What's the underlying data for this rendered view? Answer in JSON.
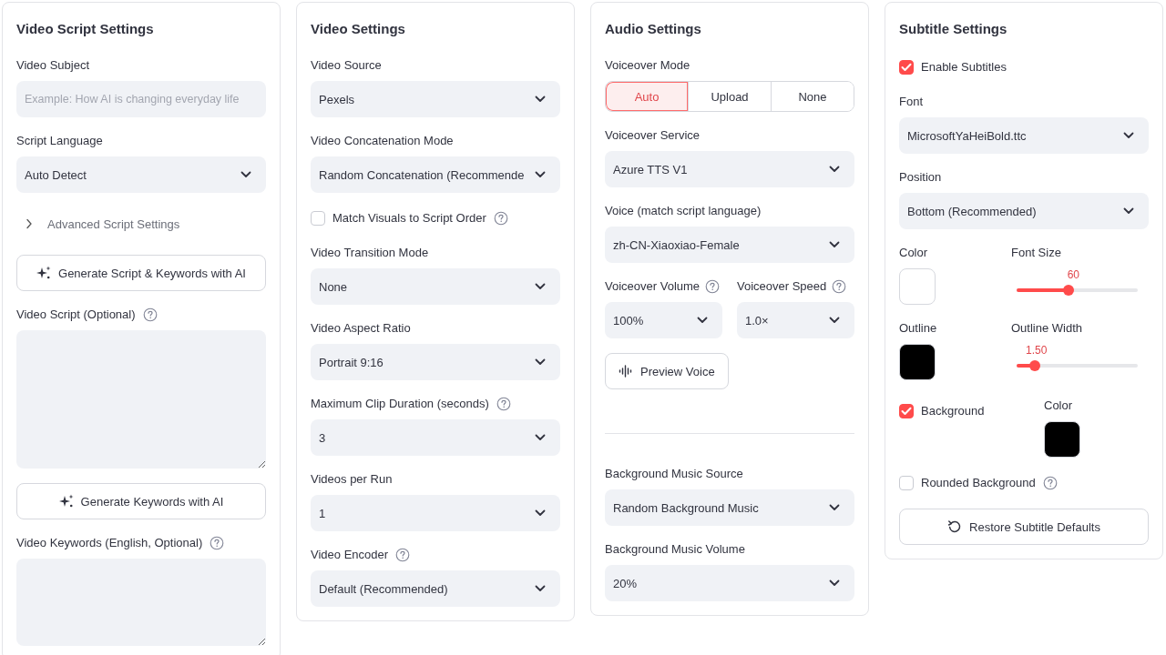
{
  "panels": [
    {
      "title": "Video Script Settings",
      "fields": [
        {
          "kind": "input",
          "label": "Video Subject",
          "placeholder": "Example: How AI is changing everyday life"
        },
        {
          "kind": "select",
          "label": "Script Language",
          "value": "Auto Detect"
        },
        {
          "kind": "expander",
          "label": "Advanced Script Settings",
          "expanded": false
        },
        {
          "kind": "aibutton",
          "label": "Generate Script & Keywords with AI"
        },
        {
          "kind": "textarea",
          "label": "Video Script (Optional)",
          "help": true
        },
        {
          "kind": "aibutton",
          "label": "Generate Keywords with AI"
        },
        {
          "kind": "textarea",
          "label": "Video Keywords (English, Optional)",
          "help": true
        }
      ]
    },
    {
      "title": "Video Settings",
      "fields": [
        {
          "kind": "select",
          "label": "Video Source",
          "value": "Pexels"
        },
        {
          "kind": "select",
          "label": "Video Concatenation Mode",
          "value": "Random Concatenation (Recommende"
        },
        {
          "kind": "checkbox",
          "label": "Match Visuals to Script Order",
          "checked": false,
          "help": true
        },
        {
          "kind": "select",
          "label": "Video Transition Mode",
          "value": "None"
        },
        {
          "kind": "select",
          "label": "Video Aspect Ratio",
          "value": "Portrait 9:16"
        },
        {
          "kind": "select",
          "label": "Maximum Clip Duration (seconds)",
          "value": "3",
          "help": true
        },
        {
          "kind": "select",
          "label": "Videos per Run",
          "value": "1"
        },
        {
          "kind": "select",
          "label": "Video Encoder",
          "value": "Default (Recommended)",
          "help": true
        }
      ]
    },
    {
      "title": "Audio Settings",
      "fields": [
        {
          "kind": "segmented",
          "label": "Voiceover Mode",
          "options": [
            {
              "label": "Auto",
              "selected": true
            },
            {
              "label": "Upload",
              "selected": false
            },
            {
              "label": "None",
              "selected": false
            }
          ]
        },
        {
          "kind": "select",
          "label": "Voiceover Service",
          "value": "Azure TTS V1"
        },
        {
          "kind": "select",
          "label": "Voice (match script language)",
          "value": "zh-CN-Xiaoxiao-Female"
        },
        {
          "kind": "row",
          "items": [
            {
              "kind": "select",
              "label": "Voiceover Volume",
              "value": "100%",
              "help": true
            },
            {
              "kind": "select",
              "label": "Voiceover Speed",
              "value": "1.0×",
              "help": true
            }
          ]
        },
        {
          "kind": "voicebutton",
          "label": "Preview Voice"
        },
        {
          "kind": "divider"
        },
        {
          "kind": "select",
          "label": "Background Music Source",
          "value": "Random Background Music"
        },
        {
          "kind": "select",
          "label": "Background Music Volume",
          "value": "20%"
        }
      ]
    },
    {
      "title": "Subtitle Settings",
      "fields": [
        {
          "kind": "checkbox",
          "label": "Enable Subtitles",
          "checked": true
        },
        {
          "kind": "select",
          "label": "Font",
          "value": "MicrosoftYaHeiBold.ttc"
        },
        {
          "kind": "select",
          "label": "Position",
          "value": "Bottom (Recommended)"
        },
        {
          "kind": "row",
          "items": [
            {
              "kind": "color",
              "label": "Color",
              "color": "#ffffff"
            },
            {
              "kind": "slider",
              "label": "Font Size",
              "value": "60",
              "level": 0.43
            }
          ]
        },
        {
          "kind": "row",
          "items": [
            {
              "kind": "color",
              "label": "Outline",
              "color": "#000000"
            },
            {
              "kind": "slider",
              "label": "Outline Width",
              "value": "1.50",
              "level": 0.15
            }
          ]
        },
        {
          "kind": "row",
          "items": [
            {
              "kind": "checkbox",
              "label": "Background",
              "checked": true
            },
            {
              "kind": "color",
              "label": "Color",
              "color": "#000000"
            }
          ]
        },
        {
          "kind": "checkbox",
          "label": "Rounded Background",
          "checked": false,
          "help": true
        },
        {
          "kind": "resetbutton",
          "label": "Restore Subtitle Defaults"
        }
      ]
    }
  ]
}
